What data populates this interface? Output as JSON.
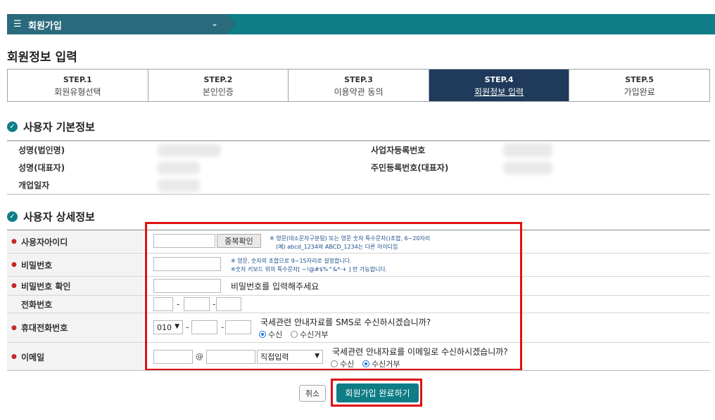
{
  "nav": {
    "menu_icon": "hamburger-icon",
    "title": "회원가입",
    "chevron": "chevron-down-icon"
  },
  "page_title": "회원정보 입력",
  "steps": [
    {
      "num": "STEP.1",
      "label": "회원유형선택",
      "active": false
    },
    {
      "num": "STEP.2",
      "label": "본인인증",
      "active": false
    },
    {
      "num": "STEP.3",
      "label": "이용약관 동의",
      "active": false
    },
    {
      "num": "STEP.4",
      "label": "회원정보 입력",
      "active": true
    },
    {
      "num": "STEP.5",
      "label": "가입완료",
      "active": false
    }
  ],
  "basic": {
    "title": "사용자 기본정보",
    "labels": {
      "corp_name": "성명(법인명)",
      "rep_name": "성명(대표자)",
      "open_date": "개업일자",
      "biz_no": "사업자등록번호",
      "resident_no": "주민등록번호(대표자)"
    }
  },
  "detail": {
    "title": "사용자 상세정보",
    "user_id": {
      "label": "사용자아이디",
      "value": "",
      "dup_button": "중복확인",
      "note_line1": "※ 영문(대소문자구분됨) 또는 영문 숫자 특수문자()조합, 6~20자리",
      "note_line2": "(예) abcd_1234와 ABCD_1234는 다른 아이디임"
    },
    "password": {
      "label": "비밀번호",
      "value": "",
      "note_line1": "※ 영문, 숫자의 조합으로 9~15자리로 설정합니다.",
      "note_line2": "※숫자 키보드 위의 특수문자[ ~!@#$%^&*-+ ] 만 가능합니다."
    },
    "password_confirm": {
      "label": "비밀번호 확인",
      "value": "",
      "hint": "비밀번호를 입력해주세요"
    },
    "phone": {
      "label": "전화번호",
      "part1": "",
      "part2": "",
      "part3": "",
      "dash": "-"
    },
    "mobile": {
      "label": "휴대전화번호",
      "prefix": "010",
      "part2": "",
      "part3": "",
      "dash": "-",
      "sms_question": "국세관련 안내자료를 SMS로 수신하시겠습니까?",
      "opt_yes": "수신",
      "opt_no": "수신거부",
      "selected": "수신"
    },
    "email": {
      "label": "이메일",
      "local": "",
      "at": "@",
      "domain": "",
      "domain_select": "직접입력",
      "question": "국세관련 안내자료를 이메일로 수신하시겠습니까?",
      "opt_yes": "수신",
      "opt_no": "수신거부",
      "selected": "수신거부"
    }
  },
  "actions": {
    "cancel": "취소",
    "submit": "회원가입 완료하기"
  },
  "colors": {
    "nav": "#0f7d86",
    "active_step": "#1f3a5a",
    "highlight": "#e01010",
    "submit": "#0f7d86"
  }
}
